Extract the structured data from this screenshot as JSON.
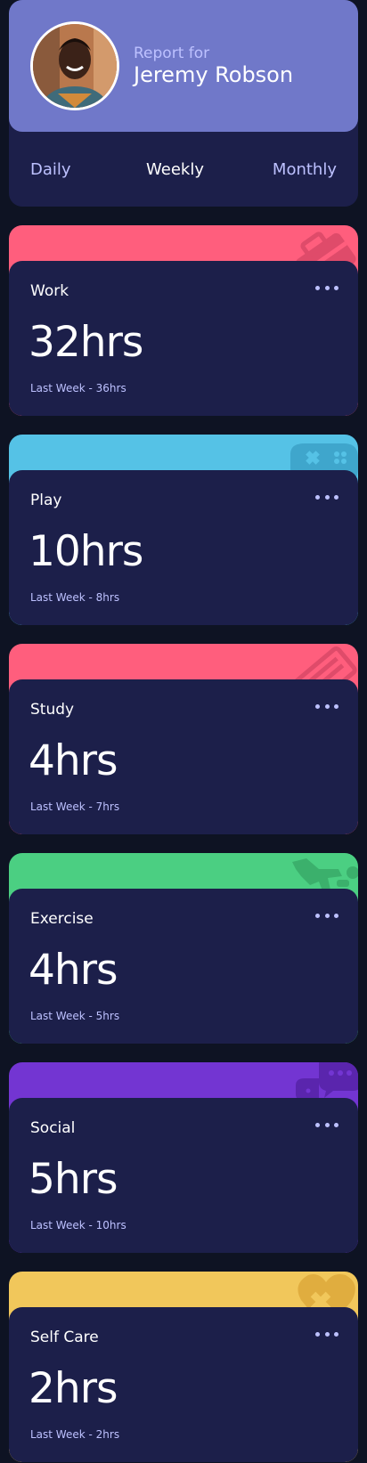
{
  "profile": {
    "report_label": "Report for",
    "name": "Jeremy Robson",
    "avatar_icon": "profile-photo"
  },
  "tabs": [
    {
      "label": "Daily",
      "active": false
    },
    {
      "label": "Weekly",
      "active": true
    },
    {
      "label": "Monthly",
      "active": false
    }
  ],
  "cards": [
    {
      "title": "Work",
      "current": "32hrs",
      "previous": "Last Week - 36hrs",
      "color": "#ff5e7d",
      "icon": "briefcase-icon"
    },
    {
      "title": "Play",
      "current": "10hrs",
      "previous": "Last Week - 8hrs",
      "color": "#55c2e6",
      "icon": "gamepad-icon"
    },
    {
      "title": "Study",
      "current": "4hrs",
      "previous": "Last Week - 7hrs",
      "color": "#ff5e7d",
      "icon": "book-icon"
    },
    {
      "title": "Exercise",
      "current": "4hrs",
      "previous": "Last Week - 5hrs",
      "color": "#4bcf82",
      "icon": "running-icon"
    },
    {
      "title": "Social",
      "current": "5hrs",
      "previous": "Last Week - 10hrs",
      "color": "#7335d2",
      "icon": "chat-icon"
    },
    {
      "title": "Self Care",
      "current": "2hrs",
      "previous": "Last Week - 2hrs",
      "color": "#f1c75b",
      "icon": "heart-icon"
    }
  ],
  "colors": {
    "background": "#0e1323",
    "card": "#1c1f4a",
    "accent": "#7078c9",
    "muted_text": "#bdc1ff"
  }
}
